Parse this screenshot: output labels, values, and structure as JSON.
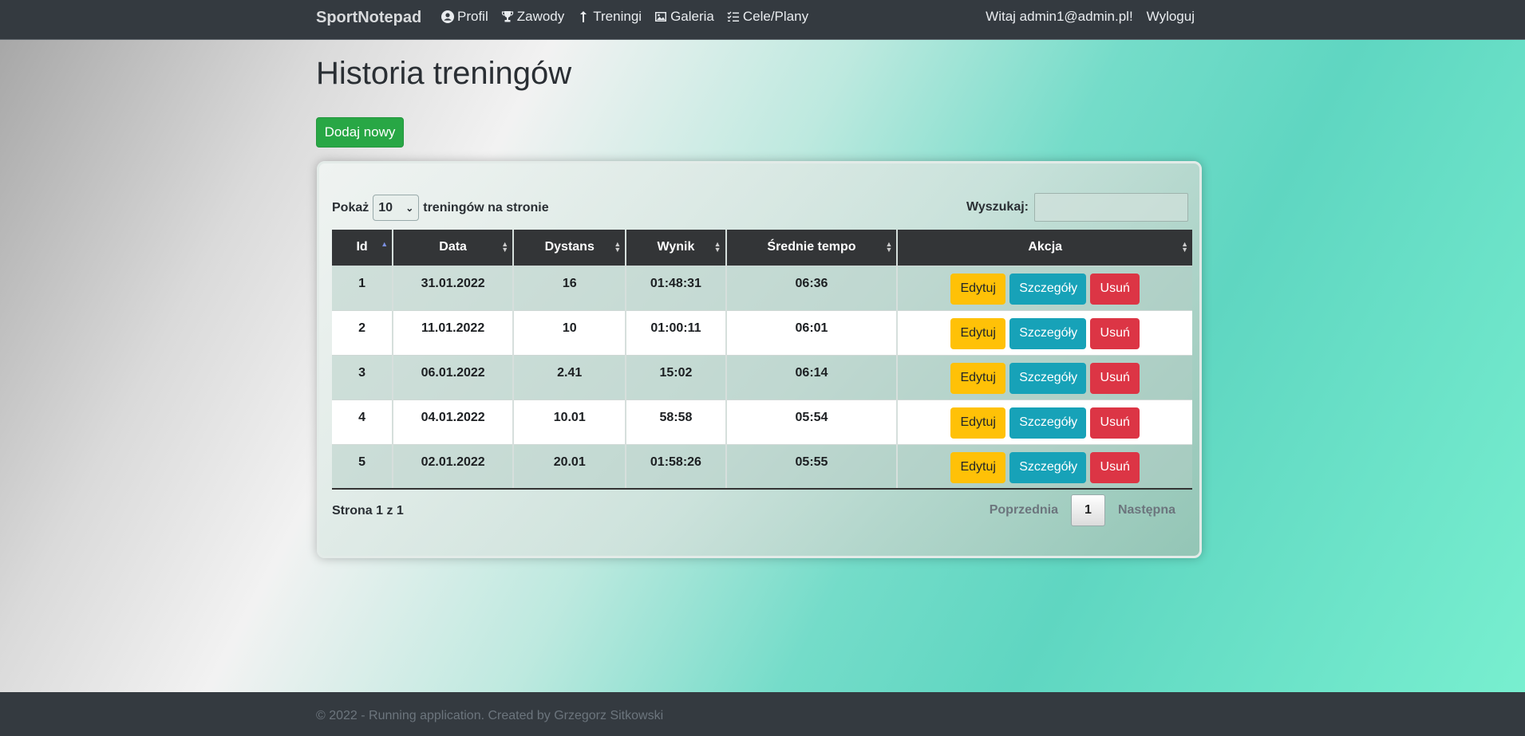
{
  "nav": {
    "brand": "SportNotepad",
    "links": [
      {
        "label": "Profil",
        "icon": "user-circle-icon"
      },
      {
        "label": "Zawody",
        "icon": "trophy-icon"
      },
      {
        "label": "Treningi",
        "icon": "arrow-up-icon"
      },
      {
        "label": "Galeria",
        "icon": "image-icon"
      },
      {
        "label": "Cele/Plany",
        "icon": "checklist-icon"
      }
    ],
    "welcome": "Witaj admin1@admin.pl!",
    "logout": "Wyloguj"
  },
  "page": {
    "title": "Historia treningów",
    "add_button": "Dodaj nowy"
  },
  "table_controls": {
    "show_label": "Pokaż",
    "page_size": "10",
    "show_suffix": "treningów na stronie",
    "search_label": "Wyszukaj:",
    "search_value": ""
  },
  "table": {
    "columns": [
      "Id",
      "Data",
      "Dystans",
      "Wynik",
      "Średnie tempo",
      "Akcja"
    ],
    "sorted_column": "Id",
    "rows": [
      {
        "id": "1",
        "date": "31.01.2022",
        "distance": "16",
        "result": "01:48:31",
        "pace": "06:36"
      },
      {
        "id": "2",
        "date": "11.01.2022",
        "distance": "10",
        "result": "01:00:11",
        "pace": "06:01"
      },
      {
        "id": "3",
        "date": "06.01.2022",
        "distance": "2.41",
        "result": "15:02",
        "pace": "06:14"
      },
      {
        "id": "4",
        "date": "04.01.2022",
        "distance": "10.01",
        "result": "58:58",
        "pace": "05:54"
      },
      {
        "id": "5",
        "date": "02.01.2022",
        "distance": "20.01",
        "result": "01:58:26",
        "pace": "05:55"
      }
    ],
    "actions": {
      "edit": "Edytuj",
      "details": "Szczegóły",
      "delete": "Usuń"
    }
  },
  "pagination": {
    "info": "Strona 1 z 1",
    "prev": "Poprzednia",
    "current": "1",
    "next": "Następna"
  },
  "footer": {
    "text": "© 2022 - Running application. Created by Grzegorz Sitkowski"
  },
  "colors": {
    "navbar": "#343a40",
    "add_button": "#28a745",
    "edit_button": "#ffc107",
    "details_button": "#17a2b8",
    "delete_button": "#dc3545"
  }
}
